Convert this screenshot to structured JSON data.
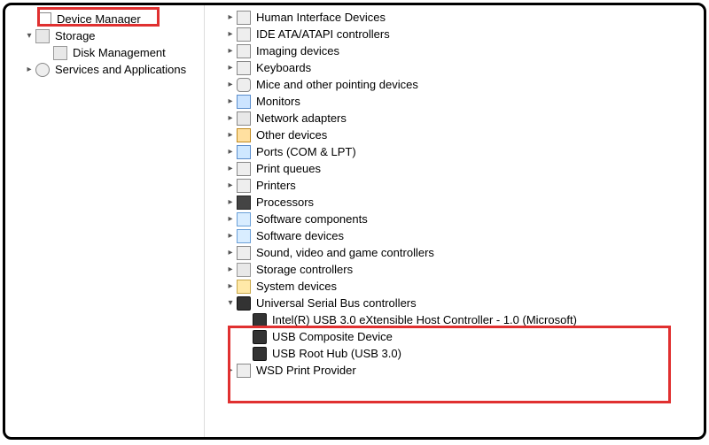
{
  "left_pane": {
    "device_manager": "Device Manager",
    "storage": "Storage",
    "disk_management": "Disk Management",
    "services_and_apps": "Services and Applications"
  },
  "categories": [
    {
      "id": "hid",
      "label": "Human Interface Devices",
      "icon": "hid-icon"
    },
    {
      "id": "ide",
      "label": "IDE ATA/ATAPI controllers",
      "icon": "ide-icon"
    },
    {
      "id": "imaging",
      "label": "Imaging devices",
      "icon": "imaging-icon"
    },
    {
      "id": "keyboards",
      "label": "Keyboards",
      "icon": "keyboard-icon"
    },
    {
      "id": "mice",
      "label": "Mice and other pointing devices",
      "icon": "mouse-icon"
    },
    {
      "id": "monitors",
      "label": "Monitors",
      "icon": "monitor-icon"
    },
    {
      "id": "network",
      "label": "Network adapters",
      "icon": "network-icon"
    },
    {
      "id": "other",
      "label": "Other devices",
      "icon": "other-devices-icon"
    },
    {
      "id": "ports",
      "label": "Ports (COM & LPT)",
      "icon": "port-icon"
    },
    {
      "id": "printq",
      "label": "Print queues",
      "icon": "printer-icon"
    },
    {
      "id": "printers",
      "label": "Printers",
      "icon": "printer-icon"
    },
    {
      "id": "processors",
      "label": "Processors",
      "icon": "processor-icon"
    },
    {
      "id": "swcomp",
      "label": "Software components",
      "icon": "software-icon"
    },
    {
      "id": "swdev",
      "label": "Software devices",
      "icon": "software-icon"
    },
    {
      "id": "sound",
      "label": "Sound, video and game controllers",
      "icon": "sound-icon"
    },
    {
      "id": "storctl",
      "label": "Storage controllers",
      "icon": "storage-controller-icon"
    },
    {
      "id": "sysdev",
      "label": "System devices",
      "icon": "system-devices-icon"
    }
  ],
  "usb_category": {
    "label": "Universal Serial Bus controllers",
    "children": [
      "Intel(R) USB 3.0 eXtensible Host Controller - 1.0 (Microsoft)",
      "USB Composite Device",
      "USB Root Hub (USB 3.0)"
    ]
  },
  "last_category": {
    "label": "WSD Print Provider",
    "icon": "printer-icon"
  },
  "icon_class": {
    "hid-icon": "ic-hid",
    "ide-icon": "ic-ide",
    "imaging-icon": "ic-img",
    "keyboard-icon": "ic-kbd",
    "mouse-icon": "ic-mouse",
    "monitor-icon": "ic-mon",
    "network-icon": "ic-net",
    "other-devices-icon": "ic-other",
    "port-icon": "ic-port",
    "printer-icon": "ic-print",
    "processor-icon": "ic-chip",
    "software-icon": "ic-sw",
    "sound-icon": "ic-snd",
    "storage-controller-icon": "ic-disk",
    "system-devices-icon": "ic-folder",
    "usb-icon": "ic-usb",
    "device-manager-icon": "ic-dev",
    "storage-icon": "ic-disk",
    "disk-management-icon": "ic-disk",
    "services-icon": "ic-gear"
  }
}
